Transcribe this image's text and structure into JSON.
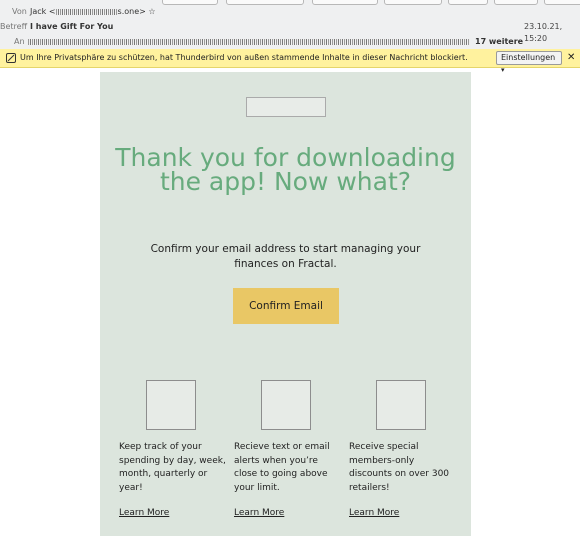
{
  "header": {
    "from_label": "Von",
    "from_name": "Jack <",
    "from_domain_suffix": "s.one>",
    "subject_label": "Betreff",
    "subject": "I have Gift For You",
    "date": "23.10.21, 15:20",
    "to_label": "An",
    "more_recipients": "17 weitere",
    "star_icon": "star-icon"
  },
  "notice": {
    "text": "Um Ihre Privatsphäre zu schützen, hat Thunderbird von außen stammende Inhalte in dieser Nachricht blockiert.",
    "settings_label": "Einstellungen",
    "close_label": "✕"
  },
  "email": {
    "headline": "Thank you for downloading the app! Now what?",
    "subtext": "Confirm your email address to start managing your finances on Fractal.",
    "confirm_label": "Confirm Email",
    "features": [
      {
        "text": "Keep track of your spending by day, week, month, quarterly or year!",
        "link": "Learn More"
      },
      {
        "text": "Recieve text or email alerts when you’re close to going above your limit.",
        "link": "Learn More"
      },
      {
        "text": "Receive special members-only discounts on over 300 retailers!",
        "link": "Learn More"
      }
    ]
  },
  "colors": {
    "email_bg": "#dce5dd",
    "headline": "#67ab7d",
    "button": "#e9c765",
    "notice_bg": "#fff29e"
  }
}
